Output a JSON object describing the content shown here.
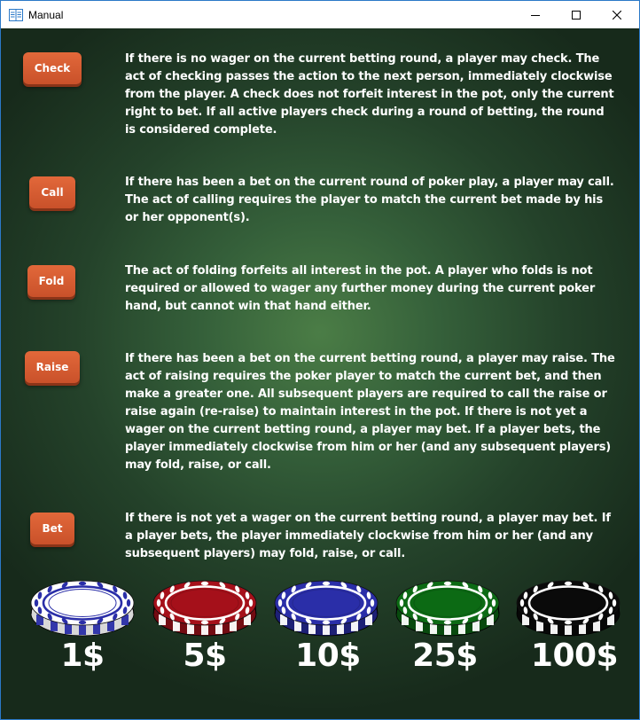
{
  "window": {
    "title": "Manual"
  },
  "actions": [
    {
      "label": "Check",
      "description": "If there is no wager on the current betting round, a player may check. The act of checking passes the action to the next person, immediately clockwise from the player. A check does not forfeit interest in the pot, only the current right to bet. If all active players check during a round of betting, the round is considered complete."
    },
    {
      "label": "Call",
      "description": "If there has been a bet on the current round of poker play, a player may call. The act of calling requires the player to match the current bet made by his or her opponent(s)."
    },
    {
      "label": "Fold",
      "description": "The act of folding forfeits all interest in the pot. A player who folds is not required or allowed to wager any further money during the current poker hand, but cannot win that hand either."
    },
    {
      "label": "Raise",
      "description": "If there has been a bet on the current betting round, a player may raise. The act of raising requires the poker player to match the current bet, and then make a greater one. All subsequent players are required to call the raise or raise again (re-raise) to maintain interest in the pot. If there is not yet a wager on the current betting round, a player may bet. If a player bets, the player immediately clockwise from him or her (and any subsequent players) may fold, raise, or call."
    },
    {
      "label": "Bet",
      "description": "If there is not yet a wager on the current betting round, a player may bet. If a player bets, the player immediately clockwise from him or her (and any subsequent players) may fold, raise, or call."
    }
  ],
  "chips": [
    {
      "value": "1$",
      "color": "#ffffff",
      "accent": "#2a2ea8"
    },
    {
      "value": "5$",
      "color": "#a5101a",
      "accent": "#ffffff"
    },
    {
      "value": "10$",
      "color": "#2a2ea8",
      "accent": "#ffffff"
    },
    {
      "value": "25$",
      "color": "#0c6a14",
      "accent": "#ffffff"
    },
    {
      "value": "100$",
      "color": "#0a0a0a",
      "accent": "#ffffff"
    }
  ]
}
